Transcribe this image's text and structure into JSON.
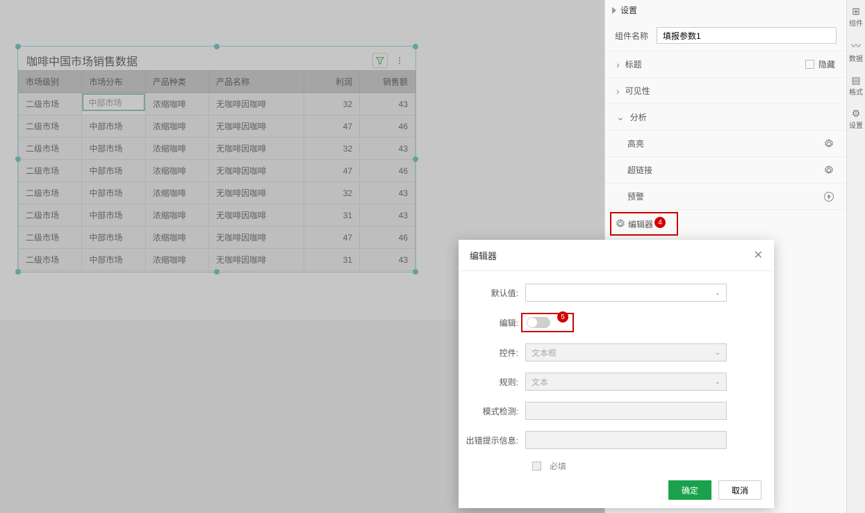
{
  "canvas": {
    "widget_title": "咖啡中国市场销售数据"
  },
  "table": {
    "headers": [
      "市场级别",
      "市场分布",
      "产品种类",
      "产品名称",
      "利润",
      "销售额"
    ],
    "rows": [
      [
        "二级市场",
        "中部市场",
        "浓缩咖啡",
        "无咖啡因咖啡",
        "32",
        "43"
      ],
      [
        "二级市场",
        "中部市场",
        "浓缩咖啡",
        "无咖啡因咖啡",
        "47",
        "46"
      ],
      [
        "二级市场",
        "中部市场",
        "浓缩咖啡",
        "无咖啡因咖啡",
        "32",
        "43"
      ],
      [
        "二级市场",
        "中部市场",
        "浓缩咖啡",
        "无咖啡因咖啡",
        "47",
        "46"
      ],
      [
        "二级市场",
        "中部市场",
        "浓缩咖啡",
        "无咖啡因咖啡",
        "32",
        "43"
      ],
      [
        "二级市场",
        "中部市场",
        "浓缩咖啡",
        "无咖啡因咖啡",
        "31",
        "43"
      ],
      [
        "二级市场",
        "中部市场",
        "浓缩咖啡",
        "无咖啡因咖啡",
        "47",
        "46"
      ],
      [
        "二级市场",
        "中部市场",
        "浓缩咖啡",
        "无咖啡因咖啡",
        "31",
        "43"
      ]
    ]
  },
  "panel": {
    "header": "设置",
    "compname_label": "组件名称",
    "compname_value": "填报参数1",
    "acc_title": "标题",
    "hide_label": "隐藏",
    "acc_visibility": "可见性",
    "acc_analysis": "分析",
    "sub_highlight": "高亮",
    "sub_hyperlink": "超链接",
    "sub_alert": "预警",
    "sub_editor": "编辑器"
  },
  "badges": {
    "b4": "4",
    "b5": "5"
  },
  "strip": {
    "s1": "组件",
    "s2": "数据",
    "s3": "格式",
    "s4": "设置"
  },
  "dialog": {
    "title": "编辑器",
    "default_label": "默认值:",
    "edit_label": "编辑:",
    "control_label": "控件:",
    "control_value": "文本框",
    "rule_label": "规则:",
    "rule_value": "文本",
    "pattern_label": "模式检测:",
    "error_label": "出错提示信息:",
    "required_label": "必填",
    "ok": "确定",
    "cancel": "取消"
  }
}
